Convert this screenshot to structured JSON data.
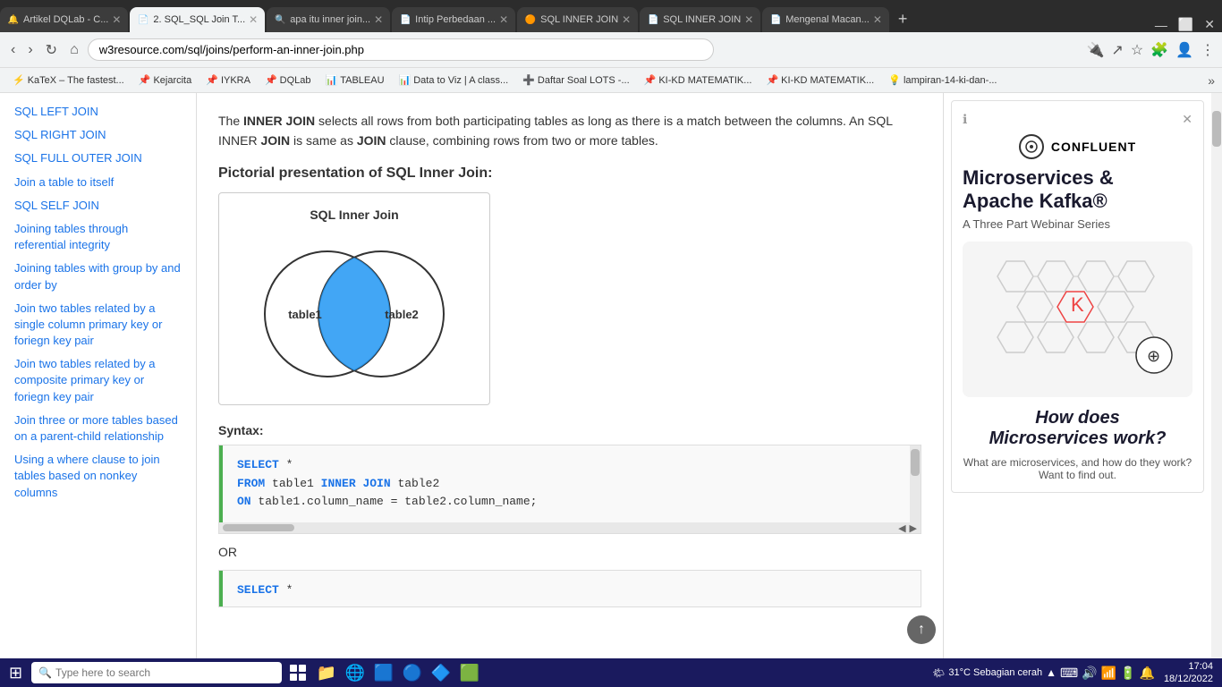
{
  "browser": {
    "tabs": [
      {
        "id": "tab1",
        "title": "Artikel DQLab - C...",
        "icon": "🔔",
        "active": false,
        "closable": true
      },
      {
        "id": "tab2",
        "title": "2. SQL_SQL Join T...",
        "icon": "📄",
        "active": true,
        "closable": true
      },
      {
        "id": "tab3",
        "title": "apa itu inner join...",
        "icon": "🔍",
        "active": false,
        "closable": true
      },
      {
        "id": "tab4",
        "title": "Intip Perbedaan ...",
        "icon": "📄",
        "active": false,
        "closable": true
      },
      {
        "id": "tab5",
        "title": "SQL INNER JOIN",
        "icon": "🟠",
        "active": false,
        "closable": true
      },
      {
        "id": "tab6",
        "title": "SQL INNER JOIN",
        "icon": "📄",
        "active": false,
        "closable": true
      },
      {
        "id": "tab7",
        "title": "Mengenal Macan...",
        "icon": "📄",
        "active": false,
        "closable": true
      }
    ],
    "address": "w3resource.com/sql/joins/perform-an-inner-join.php",
    "bookmarks": [
      {
        "label": "KaTeX – The fastest...",
        "icon": "⚡"
      },
      {
        "label": "Kejarcita",
        "icon": "📌"
      },
      {
        "label": "IYKRA",
        "icon": "📌"
      },
      {
        "label": "DQLab",
        "icon": "📌"
      },
      {
        "label": "TABLEAU",
        "icon": "📊"
      },
      {
        "label": "Data to Viz | A class...",
        "icon": "📊"
      },
      {
        "label": "Daftar Soal LOTS -...",
        "icon": "➕"
      },
      {
        "label": "KI-KD MATEMATIK...",
        "icon": "📌"
      },
      {
        "label": "KI-KD MATEMATIK...",
        "icon": "📌"
      },
      {
        "label": "lampiran-14-ki-dan-...",
        "icon": "💡"
      }
    ]
  },
  "sidebar": {
    "items": [
      {
        "label": "SQL LEFT JOIN"
      },
      {
        "label": "SQL RIGHT JOIN"
      },
      {
        "label": "SQL FULL OUTER JOIN"
      },
      {
        "label": "Join a table to itself"
      },
      {
        "label": "SQL SELF JOIN"
      },
      {
        "label": "Joining tables through referential integrity"
      },
      {
        "label": "Joining tables with group by and order by"
      },
      {
        "label": "Join two tables related by a single column primary key or foriegn key pair"
      },
      {
        "label": "Join two tables related by a composite primary key or foriegn key pair"
      },
      {
        "label": "Join three or more tables based on a parent-child relationship"
      },
      {
        "label": "Using a where clause to join tables based on nonkey columns"
      }
    ]
  },
  "main": {
    "intro_text_1": "The ",
    "inner_join_kw": "INNER JOIN",
    "intro_text_2": " selects all rows from both participating tables as long as there is a match between the columns. An SQL INNER ",
    "join_kw": "JOIN",
    "intro_text_3": " is same as ",
    "join_clause_kw": "JOIN",
    "intro_text_4": " clause, combining rows from two or more tables.",
    "section_title": "Pictorial presentation of SQL Inner Join:",
    "venn_title": "SQL Inner Join",
    "venn_table1": "table1",
    "venn_table2": "table2",
    "syntax_label": "Syntax:",
    "code1_line1": "SELECT *",
    "code1_line2": "FROM table1 INNER JOIN table2",
    "code1_line3": "ON table1.column_name = table2.column_name;",
    "or_text": "OR",
    "code2_line1": "SELECT *"
  },
  "ad": {
    "brand": "CONFLUENT",
    "title_line1": "Microservices &",
    "title_line2": "Apache Kafka®",
    "subtitle": "A Three Part Webinar Series",
    "tagline1": "How does",
    "tagline2": "Microservices work?",
    "description": "What are microservices, and how do they work? Want to find out."
  },
  "taskbar": {
    "search_placeholder": "Type here to search",
    "time": "17:04",
    "date": "18/12/2022",
    "weather": "31°C  Sebagian cerah",
    "sys_icons": [
      "🔔",
      "⌨",
      "🔊",
      "📶"
    ]
  }
}
